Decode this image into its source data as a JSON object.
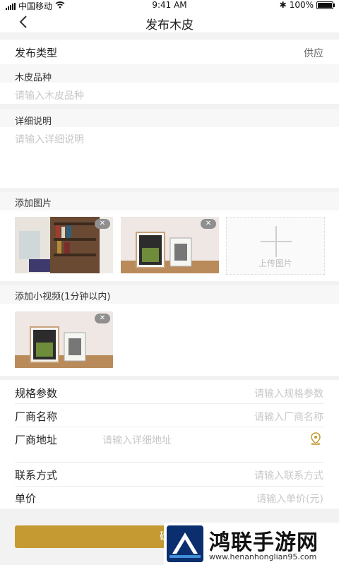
{
  "status_bar": {
    "carrier": "中国移动",
    "time": "9:41 AM",
    "battery": "100%"
  },
  "nav": {
    "title": "发布木皮"
  },
  "publish_type": {
    "label": "发布类型",
    "value": "供应"
  },
  "veneer_variety": {
    "label": "木皮品种",
    "placeholder": "请输入木皮品种"
  },
  "description": {
    "label": "详细说明",
    "placeholder": "请输入详细说明"
  },
  "images": {
    "label": "添加图片",
    "upload_label": "上传图片"
  },
  "video": {
    "label": "添加小视频(1分钟以内)"
  },
  "form": {
    "specs": {
      "label": "规格参数",
      "placeholder": "请输入规格参数"
    },
    "manufacturer": {
      "label": "厂商名称",
      "placeholder": "请输入厂商名称"
    },
    "address": {
      "label": "厂商地址",
      "placeholder": "请输入详细地址"
    },
    "contact": {
      "label": "联系方式",
      "placeholder": "请输入联系方式"
    },
    "price": {
      "label": "单价",
      "placeholder": "请输入单价(元)"
    }
  },
  "confirm_label": "确认",
  "watermark": {
    "name": "鸿联手游网",
    "url": "www.henanhonglian95.com"
  },
  "colors": {
    "accent": "#c59a32",
    "background": "#f2f2f2"
  }
}
